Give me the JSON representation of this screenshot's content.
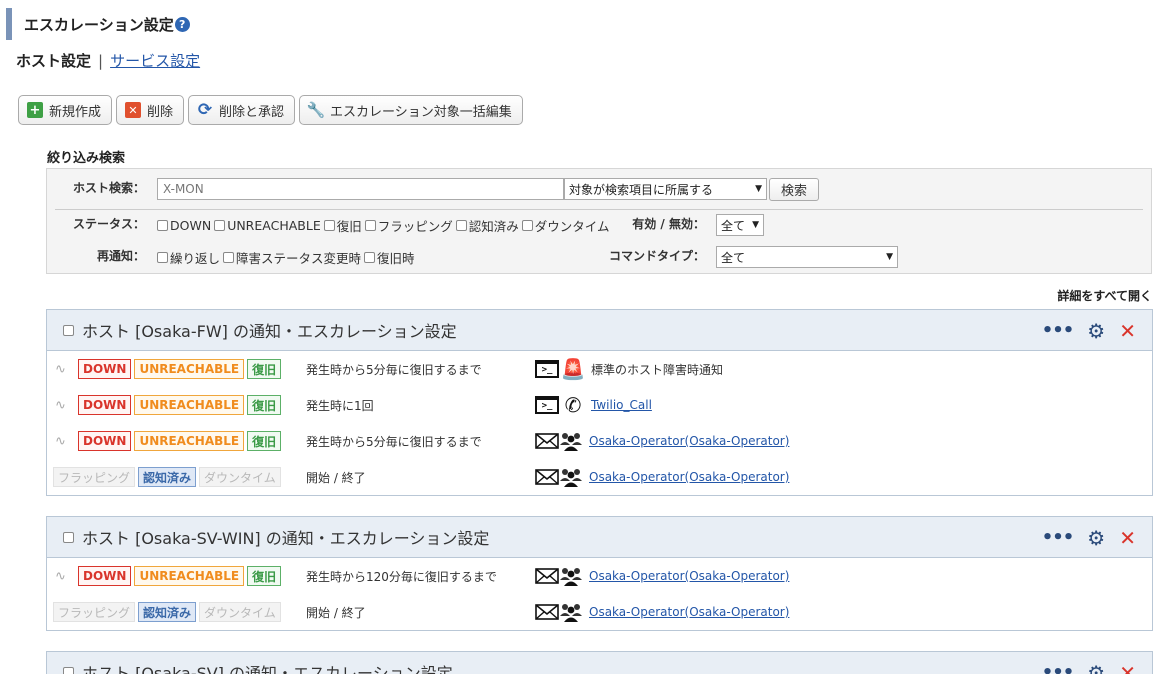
{
  "page": {
    "title": "エスカレーション設定",
    "help": "?"
  },
  "subnav": {
    "current": "ホスト設定",
    "separator": "|",
    "link": "サービス設定"
  },
  "toolbar": {
    "new": "新規作成",
    "delete": "削除",
    "delete_ack": "削除と承認",
    "bulk_edit": "エスカレーション対象一括編集"
  },
  "filter": {
    "title": "絞り込み検索",
    "host_label": "ホスト検索：",
    "host_value": "X-MON",
    "scope_select": "対象が検索項目に所属する",
    "search_button": "検索",
    "status_label": "ステータス：",
    "status_options": [
      "DOWN",
      "UNREACHABLE",
      "復旧",
      "フラッピング",
      "認知済み",
      "ダウンタイム"
    ],
    "valid_label": "有効 / 無効：",
    "valid_value": "全て",
    "renotify_label": "再通知：",
    "renotify_options": [
      "繰り返し",
      "障害ステータス変更時",
      "復旧時"
    ],
    "command_label": "コマンドタイプ：",
    "command_value": "全て"
  },
  "expand_all": "詳細をすべて開く",
  "panels": [
    {
      "title": "ホスト [Osaka-FW] の通知・エスカレーション設定",
      "rows": [
        {
          "badges": [
            "DOWN",
            "UNREACHABLE",
            "復旧"
          ],
          "text": "発生時から5分毎に復旧するまで",
          "icons": [
            "terminal-icon",
            "alarm-icon"
          ],
          "label": "標準のホスト障害時通知"
        },
        {
          "badges": [
            "DOWN",
            "UNREACHABLE",
            "復旧"
          ],
          "text": "発生時に1回",
          "icons": [
            "terminal-icon",
            "phone-icon"
          ],
          "link": "Twilio_Call"
        },
        {
          "badges": [
            "DOWN",
            "UNREACHABLE",
            "復旧"
          ],
          "text": "発生時から5分毎に復旧するまで",
          "icons": [
            "mail-icon",
            "group-icon"
          ],
          "link": "Osaka-Operator(Osaka-Operator)"
        },
        {
          "badges": [
            "フラッピング",
            "認知済み",
            "ダウンタイム"
          ],
          "text": "開始 / 終了",
          "icons": [
            "mail-icon",
            "group-icon"
          ],
          "link": "Osaka-Operator(Osaka-Operator)"
        }
      ]
    },
    {
      "title": "ホスト [Osaka-SV-WIN] の通知・エスカレーション設定",
      "rows": [
        {
          "badges": [
            "DOWN",
            "UNREACHABLE",
            "復旧"
          ],
          "text": "発生時から120分毎に復旧するまで",
          "icons": [
            "mail-icon",
            "group-icon"
          ],
          "link": "Osaka-Operator(Osaka-Operator)"
        },
        {
          "badges": [
            "フラッピング",
            "認知済み",
            "ダウンタイム"
          ],
          "text": "開始 / 終了",
          "icons": [
            "mail-icon",
            "group-icon"
          ],
          "link": "Osaka-Operator(Osaka-Operator)"
        }
      ]
    },
    {
      "title": "ホスト [Osaka-SV] の通知・エスカレーション設定"
    }
  ]
}
